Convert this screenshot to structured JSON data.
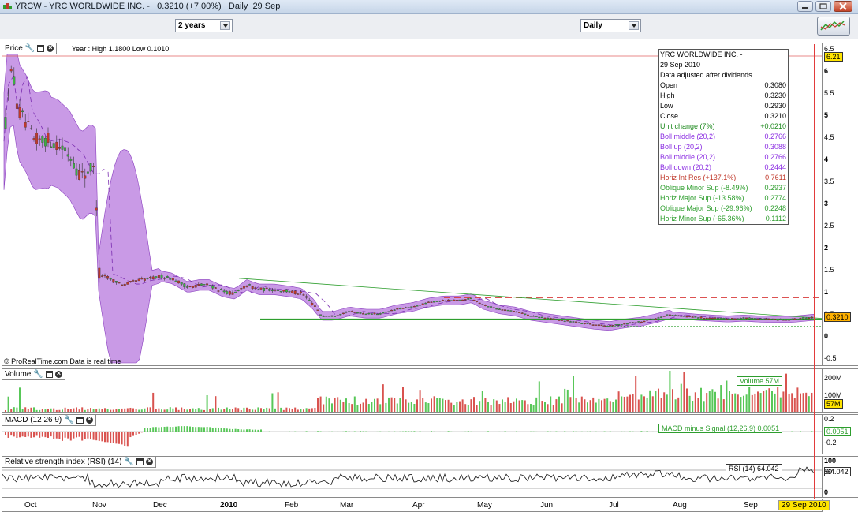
{
  "window": {
    "title": "YRCW - YRC WORLDWIDE INC. -   0.3210 (+7.00%)   Daily  29 Sep"
  },
  "toolbar": {
    "period": "2 years",
    "interval": "Daily"
  },
  "price_panel": {
    "label": "Price",
    "range_text": "Year : High 1.1800 Low 0.1010",
    "footer": "© ProRealTime.com  Data is real time",
    "last_tag": "0.3210",
    "high_tag": "6.21",
    "axis_ticks": [
      "6.5",
      "6",
      "5.5",
      "5",
      "4.5",
      "4",
      "3.5",
      "3",
      "2.5",
      "2",
      "1.5",
      "1",
      "0.5",
      "0",
      "-0.5"
    ]
  },
  "info_box": {
    "rows": [
      {
        "label": "YRC WORLDWIDE  INC. -",
        "value": ""
      },
      {
        "label": "29 Sep 2010",
        "value": ""
      },
      {
        "label": "Data adjusted after dividends",
        "value": ""
      },
      {
        "label": "Open",
        "value": "0.3080"
      },
      {
        "label": "High",
        "value": "0.3230"
      },
      {
        "label": "Low",
        "value": "0.2930"
      },
      {
        "label": "Close",
        "value": "0.3210"
      },
      {
        "label": "Unit change (7%)",
        "value": "+0.0210"
      },
      {
        "label": "Boll middle (20,2)",
        "value": "0.2766"
      },
      {
        "label": "Boll up (20,2)",
        "value": "0.3088"
      },
      {
        "label": "Boll middle (20,2)",
        "value": "0.2766"
      },
      {
        "label": "Boll down (20,2)",
        "value": "0.2444"
      },
      {
        "label": "Horiz Int Res (+137.1%)",
        "value": "0.7611"
      },
      {
        "label": "Oblique Minor Sup (-8.49%)",
        "value": "0.2937"
      },
      {
        "label": "Horiz Major Sup (-13.58%)",
        "value": "0.2774"
      },
      {
        "label": "Oblique Major Sup (-29.96%)",
        "value": "0.2248"
      },
      {
        "label": "Horiz Minor Sup (-65.36%)",
        "value": "0.1112"
      }
    ],
    "colors": {
      "black": "#000000",
      "unit": "#1f8a1f",
      "boll": "#8a2be2",
      "res": "#c0392b",
      "sup": "#2e9e2e"
    }
  },
  "volume_panel": {
    "label": "Volume",
    "legend": "Volume     57M",
    "axis_ticks": [
      "200M",
      "100M"
    ],
    "last_tag": "57M"
  },
  "macd_panel": {
    "label": "MACD (12 26 9)",
    "legend": "MACD minus Signal (12,26,9)    0.0051",
    "axis_ticks": [
      "0.2",
      "-0.2"
    ],
    "last_tag": "0.0051"
  },
  "rsi_panel": {
    "label": "Relative strength index (RSI) (14)",
    "legend": "RSI (14)    64.042",
    "axis_ticks": [
      "100",
      "50",
      "0"
    ],
    "last_tag": "64.042"
  },
  "x_axis": {
    "months": [
      "Oct",
      "Nov",
      "Dec",
      "2010",
      "Feb",
      "Mar",
      "Apr",
      "May",
      "Jun",
      "Jul",
      "Aug",
      "Sep"
    ],
    "current_date": "29 Sep 2010"
  },
  "colors": {
    "bollinger_fill": "#c99ae6",
    "bull": "#3cb043",
    "bear": "#c0392b",
    "volume_up": "#58c758",
    "volume_down": "#d9534f",
    "accent_yellow": "#ffe400"
  }
}
